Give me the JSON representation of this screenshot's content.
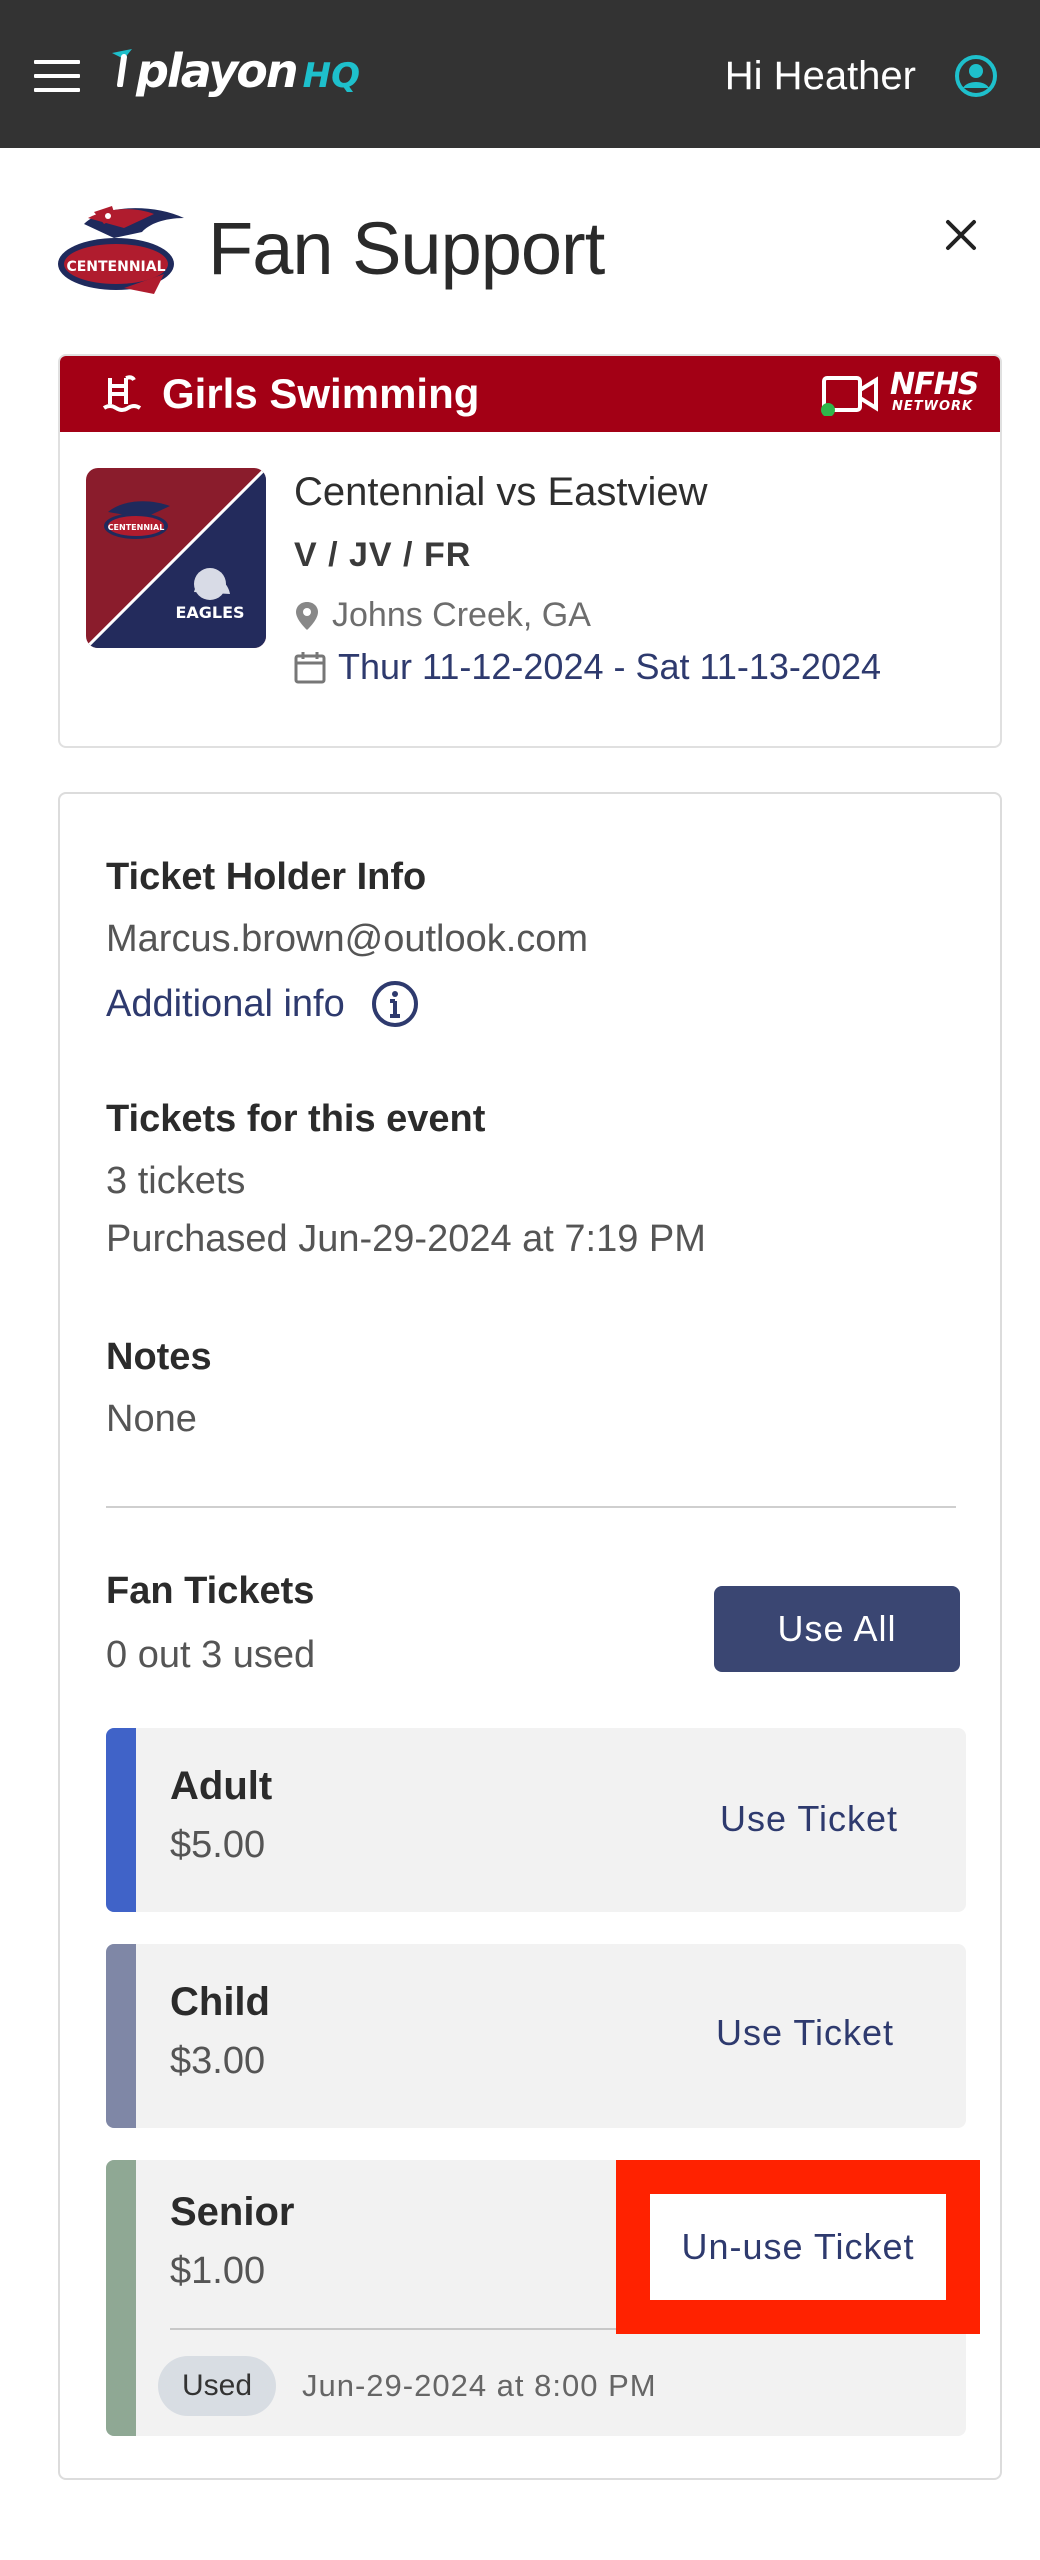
{
  "topbar": {
    "brand": "playon",
    "brand_suffix": "HQ",
    "greeting": "Hi Heather",
    "accent_color": "#1ec0cc"
  },
  "header": {
    "title": "Fan Support",
    "school_logo_text": "CENTENNIAL"
  },
  "event": {
    "sport": "Girls Swimming",
    "sport_bar_color": "#a30015",
    "network": "NFHS",
    "network_sub": "NETWORK",
    "matchup": "Centennial vs Eastview",
    "levels": "V / JV / FR",
    "location": "Johns Creek, GA",
    "dates": "Thur 11-12-2024 - Sat 11-13-2024",
    "home_logo_text": "CENTENNIAL",
    "away_logo_text": "EAGLES"
  },
  "holder": {
    "label": "Ticket Holder Info",
    "email": "Marcus.brown@outlook.com",
    "additional_info": "Additional info"
  },
  "tickets_summary": {
    "label": "Tickets for this event",
    "count": "3 tickets",
    "purchased": "Purchased Jun-29-2024 at 7:19 PM"
  },
  "notes": {
    "label": "Notes",
    "value": "None"
  },
  "fan_tickets": {
    "label": "Fan Tickets",
    "used_summary": "0 out 3 used",
    "use_all_label": "Use All",
    "items": [
      {
        "name": "Adult",
        "price": "$5.00",
        "action": "Use Ticket",
        "color": "#4063c8"
      },
      {
        "name": "Child",
        "price": "$3.00",
        "action": "Use Ticket",
        "color": "#7f87a6"
      },
      {
        "name": "Senior",
        "price": "$1.00",
        "action": "Un-use Ticket",
        "color": "#8fa894",
        "status": "Used",
        "used_time": "Jun-29-2024 at 8:00 PM"
      }
    ]
  }
}
